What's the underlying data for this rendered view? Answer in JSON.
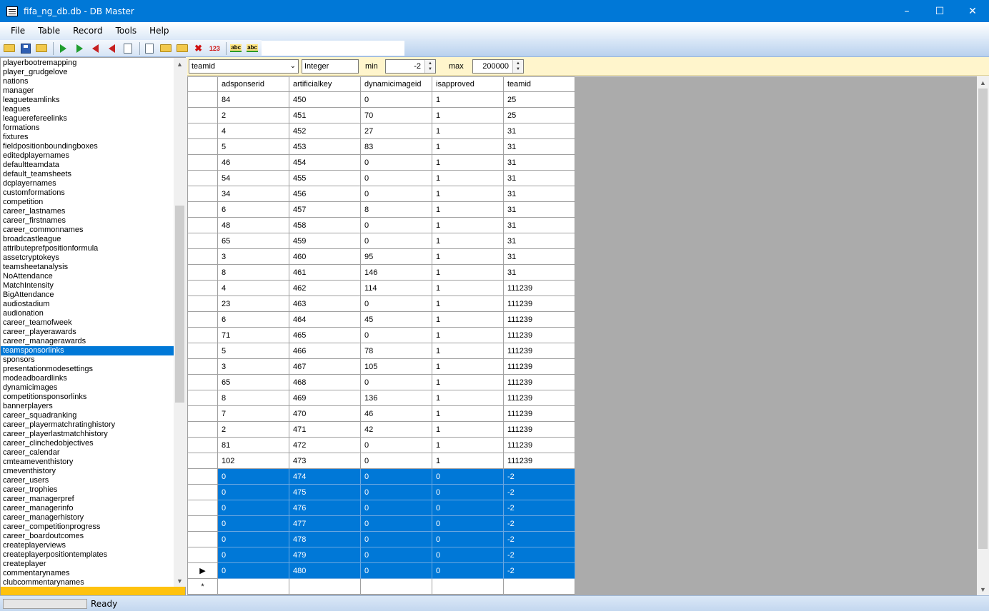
{
  "window": {
    "title": "fifa_ng_db.db - DB Master"
  },
  "menu": [
    "File",
    "Table",
    "Record",
    "Tools",
    "Help"
  ],
  "toolbar": {
    "icons": [
      "open-folder",
      "save-disk",
      "open-file",
      "import",
      "import-all",
      "export",
      "export-all",
      "compare",
      "copy",
      "paste",
      "paste-special",
      "delete",
      "number-format",
      "spellcheck",
      "spellcheck-all"
    ],
    "number_label": "123",
    "abc_label": "abc"
  },
  "tables": [
    "playerbootremapping",
    "player_grudgelove",
    "nations",
    "manager",
    "leagueteamlinks",
    "leagues",
    "leaguerefereelinks",
    "formations",
    "fixtures",
    "fieldpositionboundingboxes",
    "editedplayernames",
    "defaultteamdata",
    "default_teamsheets",
    "dcplayernames",
    "customformations",
    "competition",
    "career_lastnames",
    "career_firstnames",
    "career_commonnames",
    "broadcastleague",
    "attributeprefpositionformula",
    "assetcryptokeys",
    "teamsheetanalysis",
    "NoAttendance",
    "MatchIntensity",
    "BigAttendance",
    "audiostadium",
    "audionation",
    "career_teamofweek",
    "career_playerawards",
    "career_managerawards",
    "teamsponsorlinks",
    "sponsors",
    "presentationmodesettings",
    "modeadboardlinks",
    "dynamicimages",
    "competitionsponsorlinks",
    "bannerplayers",
    "career_squadranking",
    "career_playermatchratinghistory",
    "career_playerlastmatchhistory",
    "career_clinchedobjectives",
    "career_calendar",
    "cmteameventhistory",
    "cmeventhistory",
    "career_users",
    "career_trophies",
    "career_managerpref",
    "career_managerinfo",
    "career_managerhistory",
    "career_competitionprogress",
    "career_boardoutcomes",
    "createplayerviews",
    "createplayerpositiontemplates",
    "createplayer",
    "commentarynames",
    "clubcommentarynames"
  ],
  "selected_table": "teamsponsorlinks",
  "filter": {
    "field": "teamid",
    "type": "Integer",
    "min_label": "min",
    "min_value": "-2",
    "max_label": "max",
    "max_value": "200000"
  },
  "grid": {
    "columns": [
      "adsponserid",
      "artificialkey",
      "dynamicimageid",
      "isapproved",
      "teamid"
    ],
    "rows": [
      [
        "84",
        "450",
        "0",
        "1",
        "25"
      ],
      [
        "2",
        "451",
        "70",
        "1",
        "25"
      ],
      [
        "4",
        "452",
        "27",
        "1",
        "31"
      ],
      [
        "5",
        "453",
        "83",
        "1",
        "31"
      ],
      [
        "46",
        "454",
        "0",
        "1",
        "31"
      ],
      [
        "54",
        "455",
        "0",
        "1",
        "31"
      ],
      [
        "34",
        "456",
        "0",
        "1",
        "31"
      ],
      [
        "6",
        "457",
        "8",
        "1",
        "31"
      ],
      [
        "48",
        "458",
        "0",
        "1",
        "31"
      ],
      [
        "65",
        "459",
        "0",
        "1",
        "31"
      ],
      [
        "3",
        "460",
        "95",
        "1",
        "31"
      ],
      [
        "8",
        "461",
        "146",
        "1",
        "31"
      ],
      [
        "4",
        "462",
        "114",
        "1",
        "111239"
      ],
      [
        "23",
        "463",
        "0",
        "1",
        "111239"
      ],
      [
        "6",
        "464",
        "45",
        "1",
        "111239"
      ],
      [
        "71",
        "465",
        "0",
        "1",
        "111239"
      ],
      [
        "5",
        "466",
        "78",
        "1",
        "111239"
      ],
      [
        "3",
        "467",
        "105",
        "1",
        "111239"
      ],
      [
        "65",
        "468",
        "0",
        "1",
        "111239"
      ],
      [
        "8",
        "469",
        "136",
        "1",
        "111239"
      ],
      [
        "7",
        "470",
        "46",
        "1",
        "111239"
      ],
      [
        "2",
        "471",
        "42",
        "1",
        "111239"
      ],
      [
        "81",
        "472",
        "0",
        "1",
        "111239"
      ],
      [
        "102",
        "473",
        "0",
        "1",
        "111239"
      ],
      [
        "0",
        "474",
        "0",
        "0",
        "-2"
      ],
      [
        "0",
        "475",
        "0",
        "0",
        "-2"
      ],
      [
        "0",
        "476",
        "0",
        "0",
        "-2"
      ],
      [
        "0",
        "477",
        "0",
        "0",
        "-2"
      ],
      [
        "0",
        "478",
        "0",
        "0",
        "-2"
      ],
      [
        "0",
        "479",
        "0",
        "0",
        "-2"
      ],
      [
        "0",
        "480",
        "0",
        "0",
        "-2"
      ]
    ],
    "selected_rows": [
      24,
      25,
      26,
      27,
      28,
      29,
      30
    ],
    "current_row": 30,
    "current_marker": "▶",
    "new_row_marker": "*"
  },
  "status": {
    "text": "Ready"
  },
  "colors": {
    "titlebar": "#0078d7",
    "selection": "#0078d7",
    "filter_bg": "#fff5cc",
    "accent_yellow": "#ffc20e"
  }
}
